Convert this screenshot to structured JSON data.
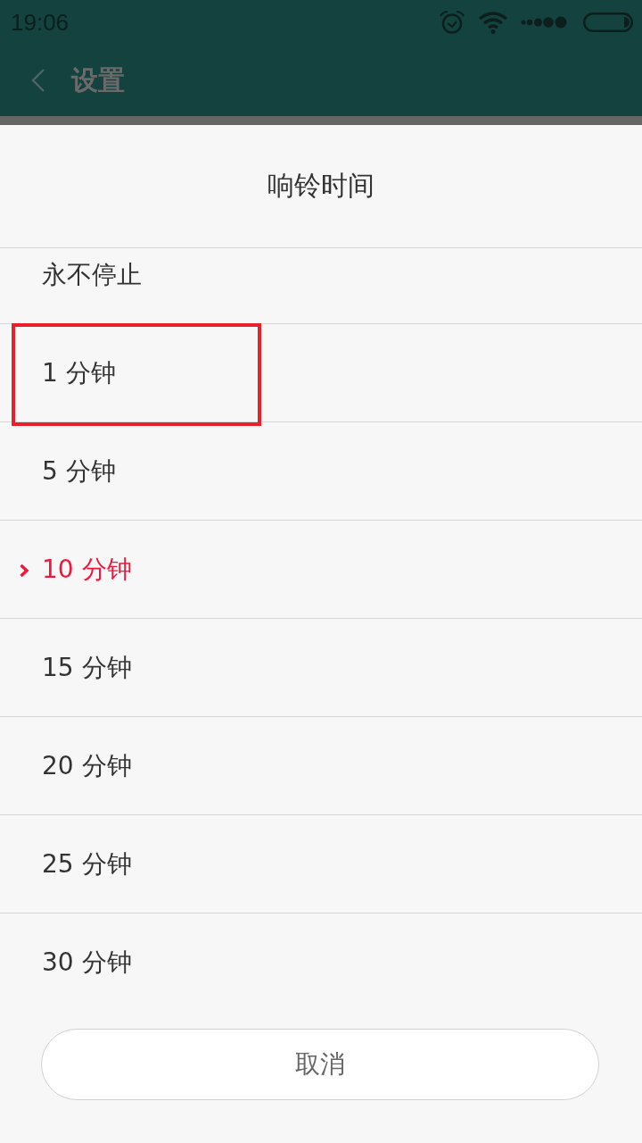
{
  "status_bar": {
    "time": "19:06"
  },
  "app_bar": {
    "title": "设置"
  },
  "dialog": {
    "title": "响铃时间",
    "items": [
      {
        "label": "永不停止",
        "selected": false,
        "highlighted": false
      },
      {
        "label": "1 分钟",
        "selected": false,
        "highlighted": true
      },
      {
        "label": "5 分钟",
        "selected": false,
        "highlighted": false
      },
      {
        "label": "10 分钟",
        "selected": true,
        "highlighted": false
      },
      {
        "label": "15 分钟",
        "selected": false,
        "highlighted": false
      },
      {
        "label": "20 分钟",
        "selected": false,
        "highlighted": false
      },
      {
        "label": "25 分钟",
        "selected": false,
        "highlighted": false
      },
      {
        "label": "30 分钟",
        "selected": false,
        "highlighted": false
      }
    ],
    "cancel_button": "取消"
  }
}
